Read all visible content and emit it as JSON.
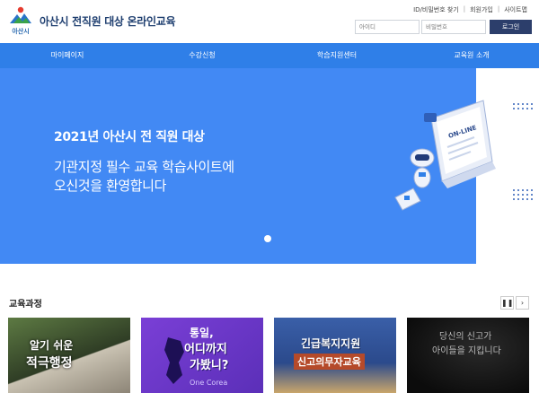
{
  "header": {
    "logo_text": "아산시",
    "site_title": "아산시 전직원 대상 온라인교육",
    "util_links": [
      "ID/비밀번호 찾기",
      "회원가입",
      "사이트맵"
    ],
    "id_placeholder": "아이디",
    "pw_placeholder": "비밀번호",
    "login_label": "로그인"
  },
  "nav": {
    "items": [
      "마이페이지",
      "수강신청",
      "학습지원센터",
      "교육원 소개"
    ]
  },
  "hero": {
    "title": "2021년 아산시 전 직원 대상",
    "sub1": "기관지정 필수 교육 학습사이트에",
    "sub2": "오신것을 환영합니다",
    "art_label": "ON-LINE",
    "bg_color": "#4289f4"
  },
  "courses": {
    "title": "교육과정",
    "pause_icon": "pause-icon",
    "next_icon": "chevron-right-icon",
    "cards": [
      {
        "line1": "알기 쉬운",
        "line2": "적극행정"
      },
      {
        "line1": "통일,",
        "line2": "어디까지",
        "line3": "가봤니?",
        "tag": "One Corea"
      },
      {
        "line1": "긴급복지지원",
        "line2": "신고의무자교육"
      },
      {
        "line1": "당신의 신고가",
        "line2": "아이들을 지킵니다"
      }
    ]
  },
  "colors": {
    "nav": "#2f7fe8",
    "brand": "#1f3f70",
    "button": "#2c3e6b"
  }
}
